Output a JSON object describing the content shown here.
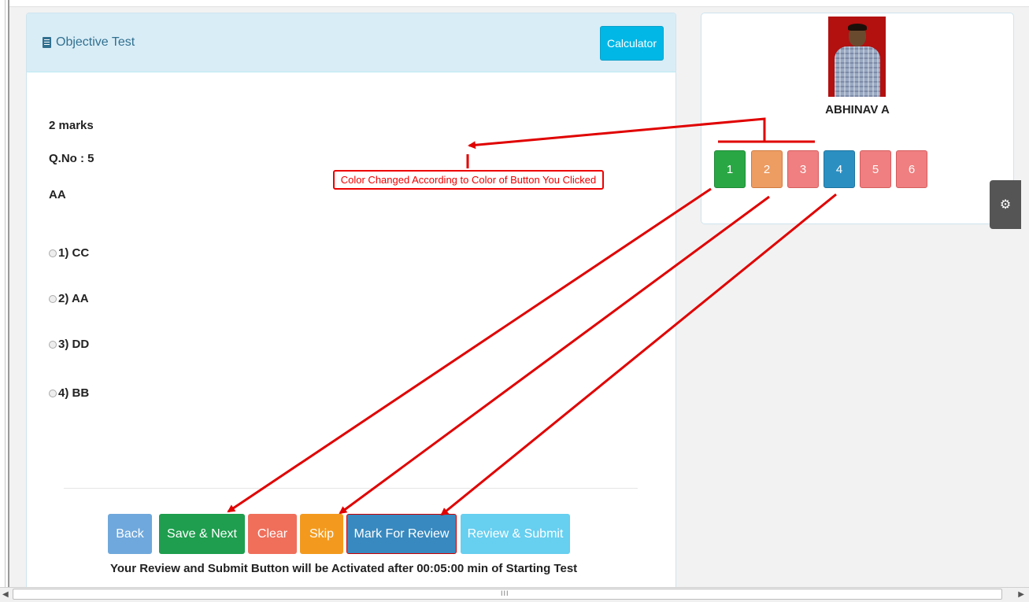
{
  "panel": {
    "title": "Objective Test",
    "calculator_label": "Calculator"
  },
  "question": {
    "marks": "2 marks",
    "number": "Q.No : 5",
    "text": "AA",
    "options": [
      "1) CC",
      "2) AA",
      "3) DD",
      "4) BB"
    ]
  },
  "actions": {
    "back": "Back",
    "save_next": "Save & Next",
    "clear": "Clear",
    "skip": "Skip",
    "mark_review": "Mark For Review",
    "review_submit": "Review & Submit"
  },
  "footer_note": "Your Review and Submit Button will be Activated after 00:05:00 min of Starting Test",
  "candidate": {
    "name": "ABHINAV A"
  },
  "palette": [
    {
      "label": "1",
      "color": "#2aa745"
    },
    {
      "label": "2",
      "color": "#ed9c62"
    },
    {
      "label": "3",
      "color": "#ef7f80"
    },
    {
      "label": "4",
      "color": "#2b8fc2"
    },
    {
      "label": "5",
      "color": "#ef7f80"
    },
    {
      "label": "6",
      "color": "#ef7f80"
    }
  ],
  "colors": {
    "back": "#6fa8dc",
    "save_next": "#1e9e4e",
    "clear": "#ef6f5b",
    "skip": "#f39a1e",
    "mark_review": "#3889bf",
    "review_submit": "#67cff0",
    "annotation": "#e00000"
  },
  "annotation": {
    "text": "Color Changed According to Color of Button You Clicked"
  },
  "icons": {
    "title": "document-icon",
    "settings": "gear-icon"
  },
  "scrollbar": {
    "grip": "III"
  }
}
